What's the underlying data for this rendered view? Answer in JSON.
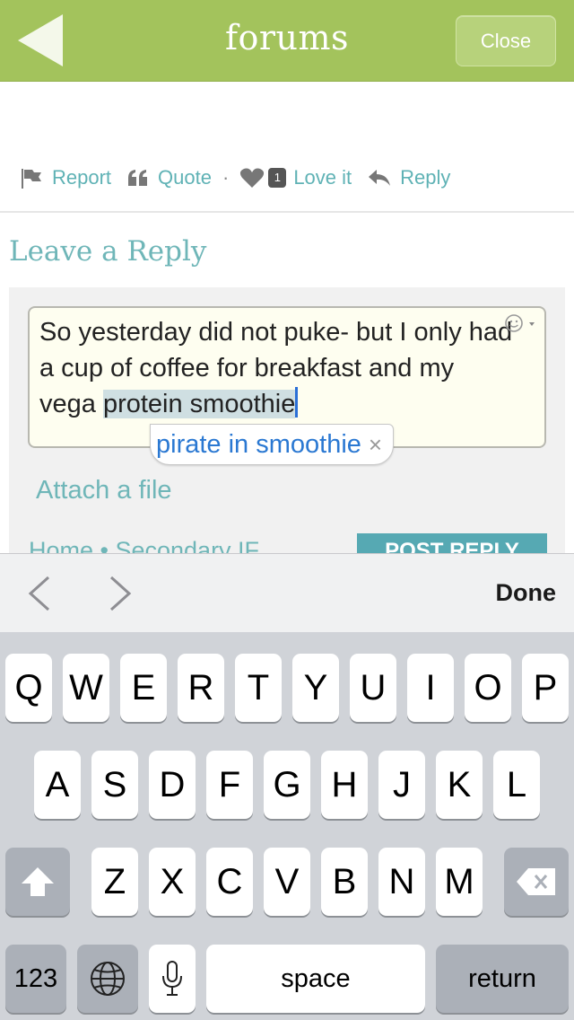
{
  "header": {
    "title": "forums",
    "close_label": "Close",
    "back_icon": "back-arrow-icon"
  },
  "actions": {
    "report": "Report",
    "quote": "Quote",
    "separator": "·",
    "love_count": "1",
    "love": "Love it",
    "reply": "Reply"
  },
  "reply_section": {
    "title": "Leave a Reply",
    "text_before": "So yesterday did not puke- but I only had a cup of coffee for breakfast and my vega ",
    "text_selected": "protein smoothie",
    "suggestion": "pirate in smoothie",
    "suggestion_dismiss": "×",
    "attach": "Attach a file",
    "breadcrumbs": "Home • Secondary IF",
    "post_button": "POST REPLY"
  },
  "toolbar": {
    "done": "Done"
  },
  "keyboard": {
    "row1": [
      "Q",
      "W",
      "E",
      "R",
      "T",
      "Y",
      "U",
      "I",
      "O",
      "P"
    ],
    "row2": [
      "A",
      "S",
      "D",
      "F",
      "G",
      "H",
      "J",
      "K",
      "L"
    ],
    "row3": [
      "Z",
      "X",
      "C",
      "V",
      "B",
      "N",
      "M"
    ],
    "numbers": "123",
    "space": "space",
    "return": "return"
  },
  "colors": {
    "header_bg": "#a3c35c",
    "link": "#5fb2b5",
    "selection": "#cfdfe2",
    "suggestion_text": "#2a78d2"
  }
}
